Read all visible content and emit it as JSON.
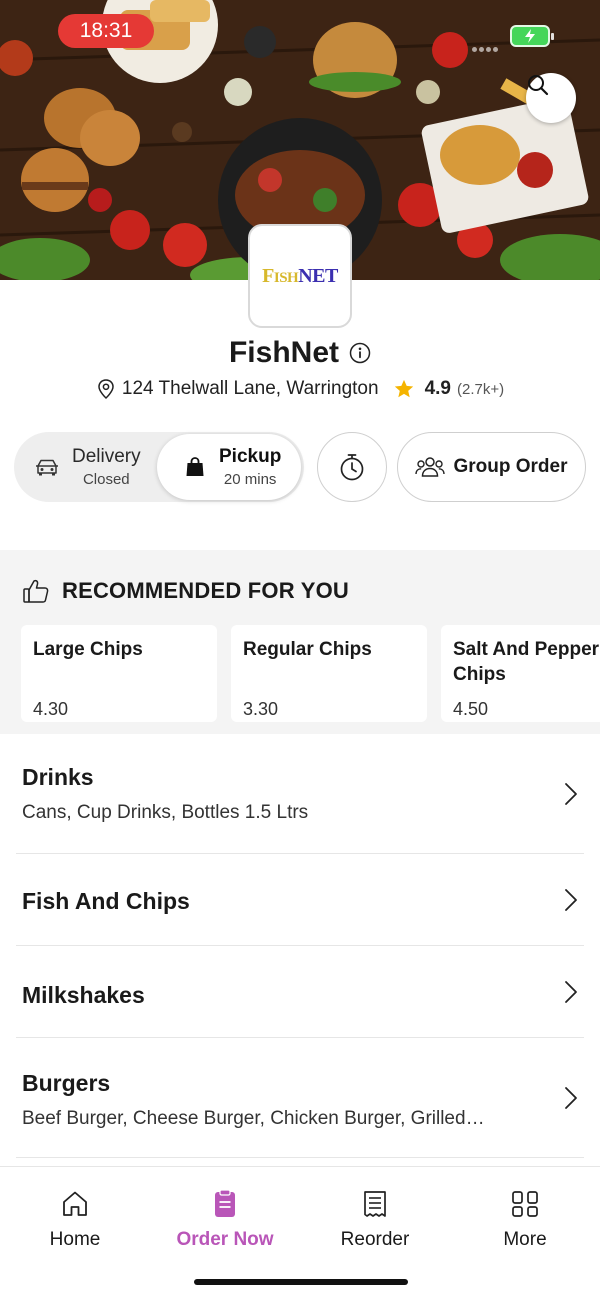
{
  "status_bar": {
    "time": "18:31"
  },
  "store": {
    "logo_text_1": "F",
    "logo_text_2": "ISH",
    "logo_text_3": "NET",
    "name": "FishNet",
    "address": "124 Thelwall Lane, Warrington",
    "rating": "4.9",
    "rating_count": "(2.7k+)"
  },
  "order_mode": {
    "delivery": {
      "label": "Delivery",
      "status": "Closed"
    },
    "pickup": {
      "label": "Pickup",
      "time": "20 mins"
    },
    "group_order_label": "Group Order"
  },
  "recommended": {
    "title": "RECOMMENDED FOR YOU",
    "items": [
      {
        "name": "Large Chips",
        "price": "4.30"
      },
      {
        "name": "Regular Chips",
        "price": "3.30"
      },
      {
        "name": "Salt And Pepper Chips",
        "price": "4.50"
      }
    ]
  },
  "categories": [
    {
      "title": "Drinks",
      "subtitle": "Cans, Cup Drinks, Bottles 1.5 Ltrs"
    },
    {
      "title": "Fish And Chips",
      "subtitle": ""
    },
    {
      "title": "Milkshakes",
      "subtitle": ""
    },
    {
      "title": "Burgers",
      "subtitle": "Beef Burger, Cheese Burger, Chicken Burger, Grilled…"
    }
  ],
  "bottom_nav": {
    "items": [
      {
        "label": "Home",
        "icon": "home-icon"
      },
      {
        "label": "Order Now",
        "icon": "order-icon",
        "active": true
      },
      {
        "label": "Reorder",
        "icon": "receipt-icon"
      },
      {
        "label": "More",
        "icon": "grid-icon"
      }
    ]
  },
  "colors": {
    "accent": "#b956b8",
    "status_pill": "#e53935",
    "star": "#f5b400",
    "battery": "#45d65a"
  }
}
